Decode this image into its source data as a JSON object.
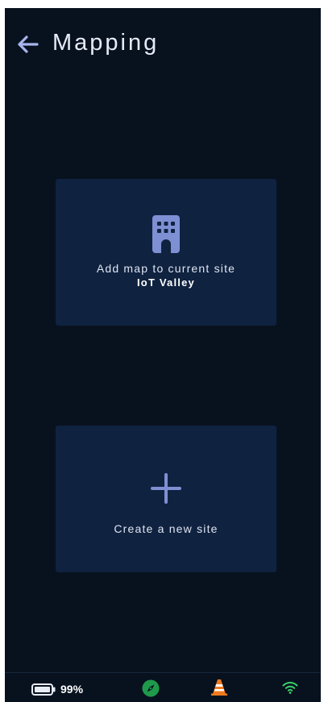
{
  "header": {
    "title": "Mapping",
    "back_icon": "arrow-left-icon"
  },
  "cards": {
    "add_map": {
      "icon": "building-icon",
      "label": "Add map to current site",
      "site_name": "IoT Valley"
    },
    "new_site": {
      "icon": "plus-icon",
      "label": "Create a new site"
    }
  },
  "status_bar": {
    "battery_percent": "99%",
    "battery_icon": "battery-icon",
    "compass_icon": "compass-icon",
    "cone_icon": "traffic-cone-icon",
    "wifi_icon": "wifi-icon"
  },
  "colors": {
    "background": "#08121f",
    "card": "#0f2240",
    "accent": "#7f8fd3",
    "compass_green": "#1f9a4b",
    "cone_orange": "#f07b1f",
    "wifi_green": "#3ccf6a"
  }
}
